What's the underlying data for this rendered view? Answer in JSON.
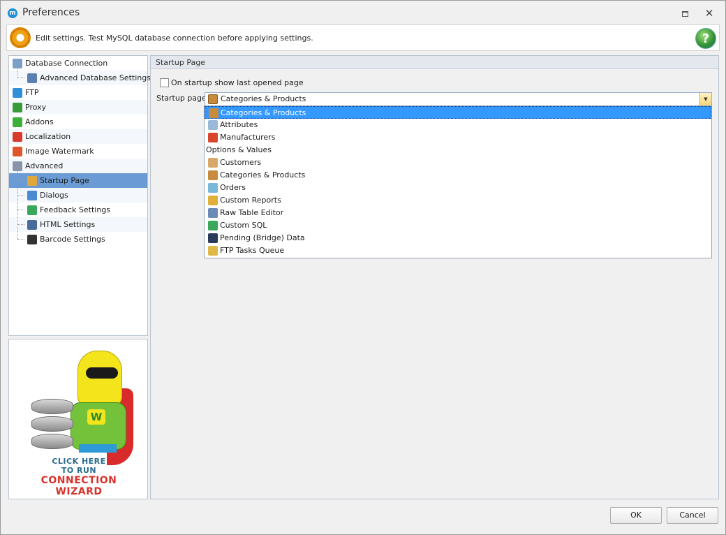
{
  "window": {
    "title": "Preferences",
    "restore_label": "",
    "close_label": "✕"
  },
  "banner": {
    "text": "Edit settings. Test MySQL database connection before applying settings."
  },
  "sidebar": {
    "items": [
      {
        "label": "Database Connection",
        "icon": "database-connection-icon",
        "color": "#7aa0c8"
      },
      {
        "label": "Advanced Database Settings",
        "icon": "database-settings-icon",
        "color": "#5a7fb0"
      },
      {
        "label": "FTP",
        "icon": "ftp-globe-icon",
        "color": "#2f8fd8"
      },
      {
        "label": "Proxy",
        "icon": "proxy-globe-icon",
        "color": "#3a9a3a"
      },
      {
        "label": "Addons",
        "icon": "addons-puzzle-icon",
        "color": "#3ab03a"
      },
      {
        "label": "Localization",
        "icon": "localization-flag-icon",
        "color": "#d83a2b"
      },
      {
        "label": "Image Watermark",
        "icon": "image-watermark-icon",
        "color": "#e0552b"
      },
      {
        "label": "Advanced",
        "icon": "advanced-shield-icon",
        "color": "#8a94a8"
      },
      {
        "label": "Startup Page",
        "icon": "startup-page-icon",
        "color": "#e0a83a"
      },
      {
        "label": "Dialogs",
        "icon": "dialogs-icon",
        "color": "#4a8ad0"
      },
      {
        "label": "Feedback Settings",
        "icon": "feedback-chart-icon",
        "color": "#3aa85a"
      },
      {
        "label": "HTML Settings",
        "icon": "html-icon",
        "color": "#4a6a9a"
      },
      {
        "label": "Barcode Settings",
        "icon": "barcode-icon",
        "color": "#333333"
      }
    ]
  },
  "wizard": {
    "line1": "CLICK HERE",
    "line2": "TO RUN",
    "line3": "CONNECTION",
    "line4": "WIZARD",
    "badge": "W"
  },
  "panel": {
    "header": "Startup Page",
    "checkbox_label": "On startup show last opened page",
    "checkbox_checked": false,
    "field_label": "Startup page",
    "selected_value": "Categories & Products"
  },
  "dropdown": {
    "items": [
      {
        "label": "Categories & Products",
        "icon": "categories-products-icon",
        "color": "#c88a3c"
      },
      {
        "label": "Attributes",
        "icon": "attributes-shield-icon",
        "color": "#9ab8d8"
      },
      {
        "label": "Manufacturers",
        "icon": "manufacturers-factory-icon",
        "color": "#d8452b"
      },
      {
        "label": "Options & Values",
        "group": true
      },
      {
        "label": "Customers",
        "icon": "customers-person-icon",
        "color": "#d8a86a"
      },
      {
        "label": "Categories & Products",
        "icon": "categories-products-icon",
        "color": "#c88a3c"
      },
      {
        "label": "Orders",
        "icon": "orders-icon",
        "color": "#7ab8d8"
      },
      {
        "label": "Custom Reports",
        "icon": "custom-reports-icon",
        "color": "#e0b03a"
      },
      {
        "label": "Raw Table Editor",
        "icon": "raw-table-editor-icon",
        "color": "#6a8ab8"
      },
      {
        "label": "Custom SQL",
        "icon": "custom-sql-icon",
        "color": "#3aa85a"
      },
      {
        "label": "Pending (Bridge) Data",
        "icon": "pending-data-icon",
        "color": "#2a3a5a"
      },
      {
        "label": "FTP Tasks Queue",
        "icon": "ftp-tasks-queue-icon",
        "color": "#e0b84a"
      }
    ]
  },
  "buttons": {
    "ok": "OK",
    "cancel": "Cancel"
  },
  "colors": {
    "selection": "#3399ff",
    "tree_selection": "#6b9bd4",
    "combo_button": "#f5d67a"
  }
}
